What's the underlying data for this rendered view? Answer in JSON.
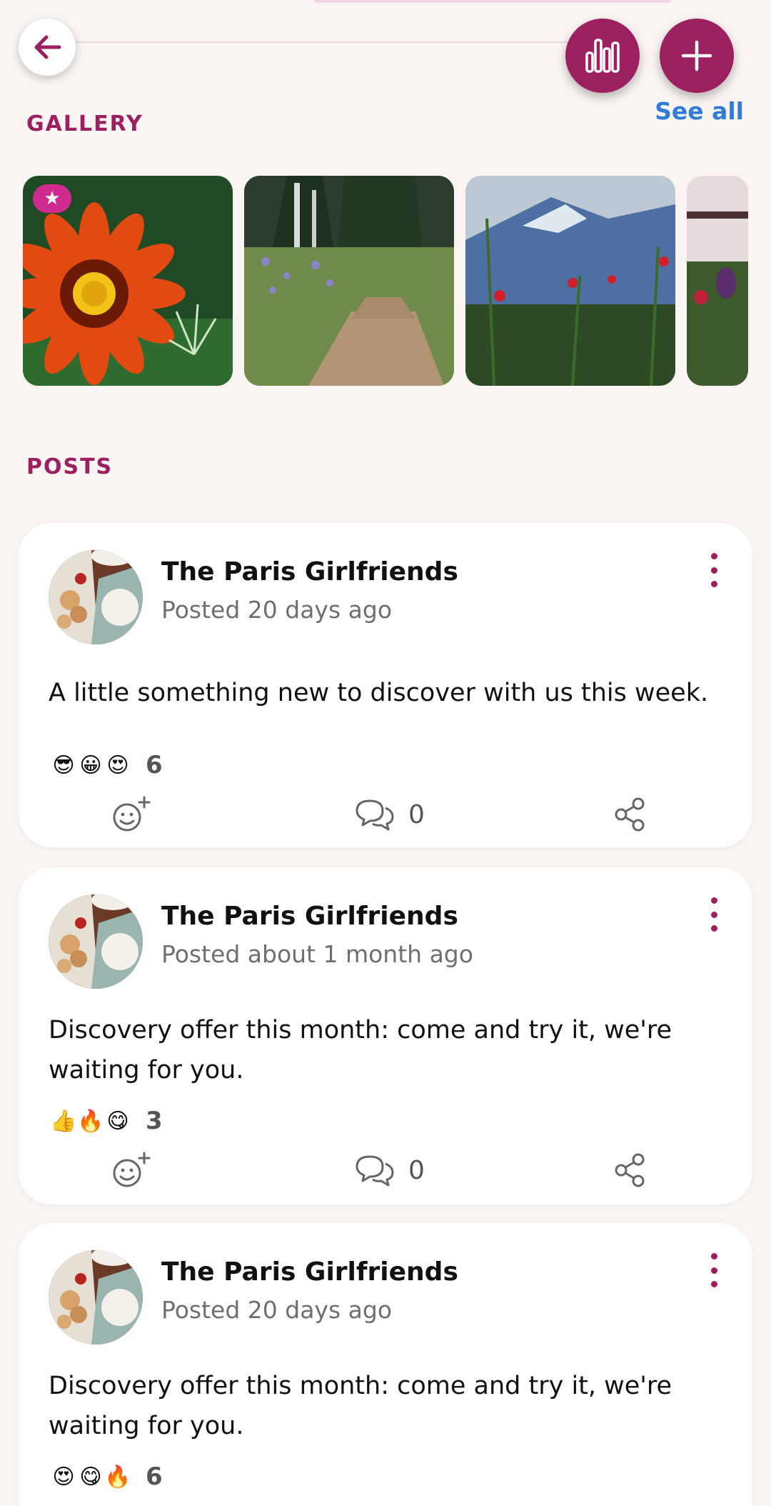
{
  "header": {
    "back_icon": "arrow-left-icon",
    "stats_icon": "bar-chart-icon",
    "add_icon": "plus-icon"
  },
  "gallery": {
    "title": "GALLERY",
    "see_all": "See all",
    "tiles": [
      {
        "subject": "orange flower",
        "starred": true
      },
      {
        "subject": "forest path",
        "starred": false
      },
      {
        "subject": "mountain flowers",
        "starred": false
      },
      {
        "subject": "purple flower",
        "starred": false
      }
    ]
  },
  "posts": {
    "title": "POSTS",
    "items": [
      {
        "author": "The Paris Girlfriends",
        "posted": "Posted 20 days ago",
        "text": "A little something new to discover with us this week.",
        "reactions": [
          "😎",
          "😀",
          "😍"
        ],
        "reaction_count": "6",
        "comment_count": "0"
      },
      {
        "author": "The Paris Girlfriends",
        "posted": "Posted about 1 month ago",
        "text": "Discovery offer this month: come and try it, we're waiting for you.",
        "reactions": [
          "👍",
          "🔥",
          "😋"
        ],
        "reaction_count": "3",
        "comment_count": "0"
      },
      {
        "author": "The Paris Girlfriends",
        "posted": "Posted 20 days ago",
        "text": "Discovery offer this month: come and try it, we're waiting for you.",
        "reactions": [
          "😍",
          "😋",
          "🔥"
        ],
        "reaction_count": "6",
        "comment_count": ""
      }
    ]
  },
  "colors": {
    "accent": "#9c1f60",
    "link": "#2f7dd6",
    "background": "#faf5f3"
  }
}
